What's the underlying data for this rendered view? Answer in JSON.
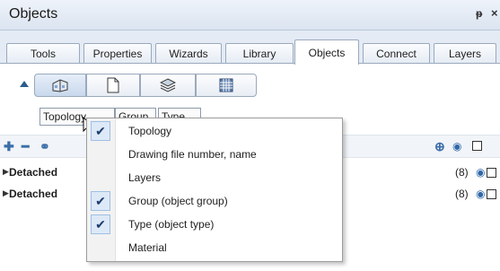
{
  "window": {
    "title": "Objects",
    "pin_glyph": "Ȅ",
    "close_glyph": "×"
  },
  "tabs": [
    {
      "label": "Tools",
      "active": false
    },
    {
      "label": "Properties",
      "active": false
    },
    {
      "label": "Wizards",
      "active": false
    },
    {
      "label": "Library",
      "active": false
    },
    {
      "label": "Objects",
      "active": true
    },
    {
      "label": "Connect",
      "active": false
    },
    {
      "label": "Layers",
      "active": false
    }
  ],
  "view_buttons": [
    {
      "icon": "building-icon"
    },
    {
      "icon": "document-icon"
    },
    {
      "icon": "layers-icon"
    },
    {
      "icon": "grid-icon"
    }
  ],
  "group_chips": [
    "Topology",
    "Group",
    "Type"
  ],
  "toolbar": {
    "icons": [
      "add-icon",
      "remove-icon",
      "link-icon",
      "zoom-icon",
      "eye-icon",
      "checkbox-icon"
    ]
  },
  "rows": [
    {
      "label": "Detached",
      "count": "(8)"
    },
    {
      "label": "Detached",
      "count": "(8)"
    }
  ],
  "menu": {
    "items": [
      {
        "label": "Topology",
        "checked": true
      },
      {
        "label": "Drawing file number, name",
        "checked": false
      },
      {
        "label": "Layers",
        "checked": false
      },
      {
        "label": "Group (object group)",
        "checked": true
      },
      {
        "label": "Type (object type)",
        "checked": true
      },
      {
        "label": "Material",
        "checked": false
      }
    ]
  },
  "colors": {
    "accent": "#2f67a8",
    "check_bg": "#dde9f7",
    "tab_border": "#9aa9bd"
  }
}
